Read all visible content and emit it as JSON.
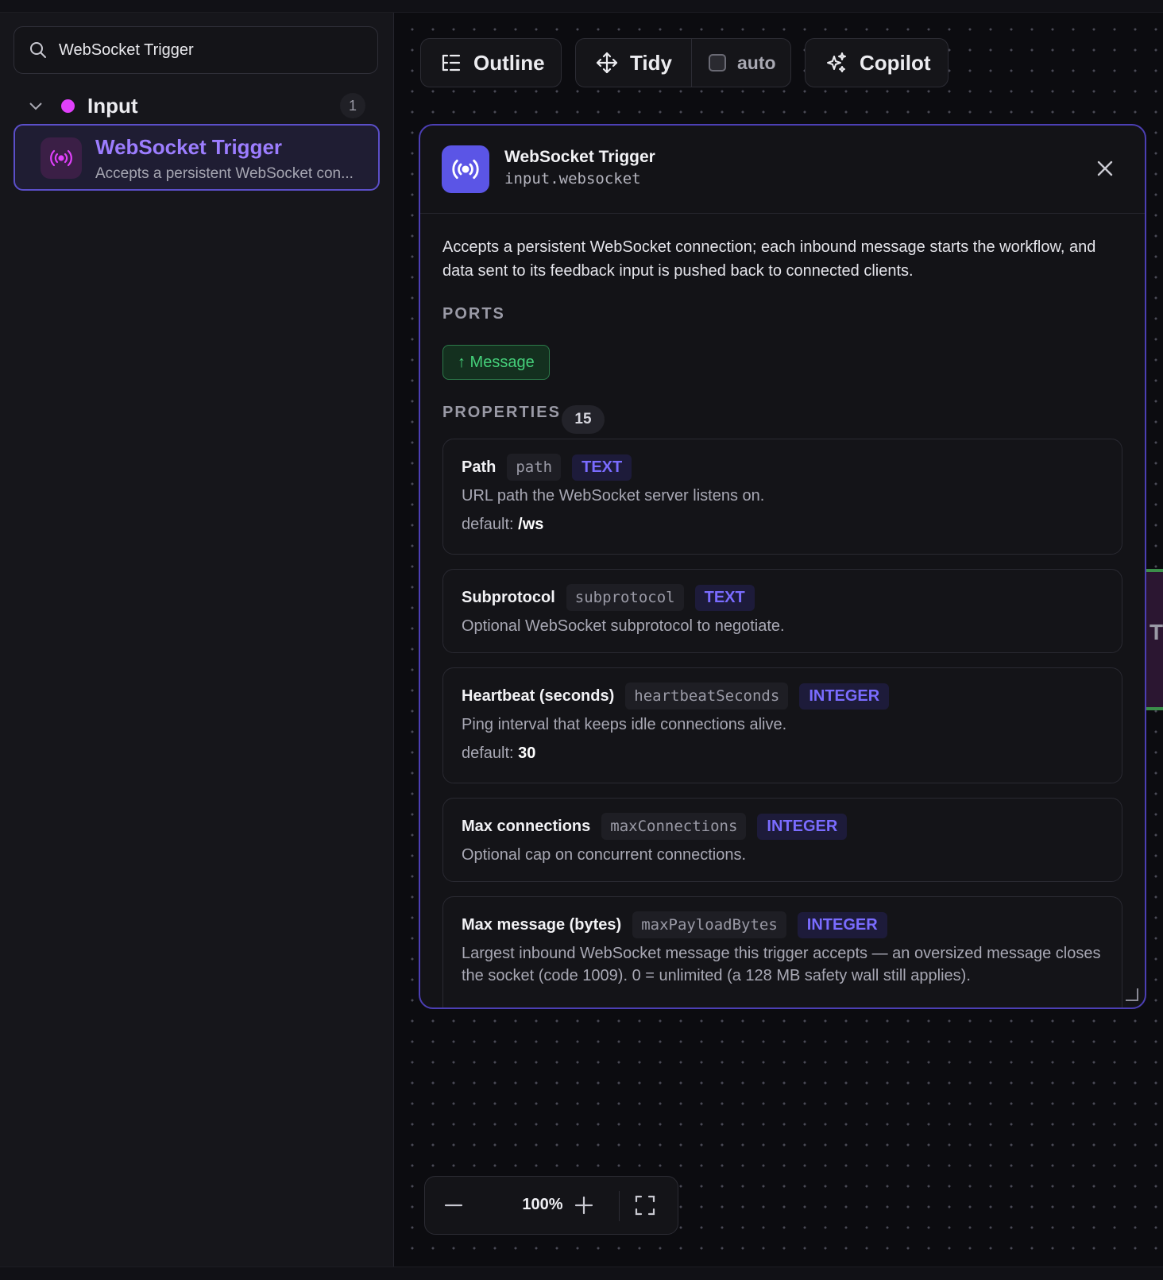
{
  "sidebar": {
    "search": {
      "value": "WebSocket Trigger",
      "icon": "search-icon"
    },
    "group": {
      "label": "Input",
      "count": "1",
      "dot_color": "#e040fb"
    },
    "items": [
      {
        "title": "WebSocket Trigger",
        "desc": "Accepts a persistent WebSocket con...",
        "icon": "broadcast-icon"
      }
    ]
  },
  "toolbar": {
    "outline_label": "Outline",
    "tidy_label": "Tidy",
    "auto_label": "auto",
    "copilot_label": "Copilot"
  },
  "inspector": {
    "title": "WebSocket Trigger",
    "id": "input.websocket",
    "description": "Accepts a persistent WebSocket connection; each inbound message starts the workflow, and data sent to its feedback input is pushed back to connected clients.",
    "ports_label": "PORTS",
    "port": "↑ Message",
    "properties_label": "PROPERTIES",
    "properties_count": "15",
    "properties": [
      {
        "name": "Path",
        "key": "path",
        "type": "TEXT",
        "desc": "URL path the WebSocket server listens on.",
        "default_label": "default:",
        "default": "/ws"
      },
      {
        "name": "Subprotocol",
        "key": "subprotocol",
        "type": "TEXT",
        "desc": "Optional WebSocket subprotocol to negotiate."
      },
      {
        "name": "Heartbeat (seconds)",
        "key": "heartbeatSeconds",
        "type": "INTEGER",
        "desc": "Ping interval that keeps idle connections alive.",
        "default_label": "default:",
        "default": "30"
      },
      {
        "name": "Max connections",
        "key": "maxConnections",
        "type": "INTEGER",
        "desc": "Optional cap on concurrent connections."
      },
      {
        "name": "Max message (bytes)",
        "key": "maxPayloadBytes",
        "type": "INTEGER",
        "desc": "Largest inbound WebSocket message this trigger accepts — an oversized message closes the socket (code 1009). 0 = unlimited (a 128 MB safety wall still applies)."
      }
    ]
  },
  "zoom": {
    "value": "100%"
  },
  "colors": {
    "accent": "#7a6cff",
    "port_green": "#45d07a",
    "node_border": "#5b4fc9"
  }
}
